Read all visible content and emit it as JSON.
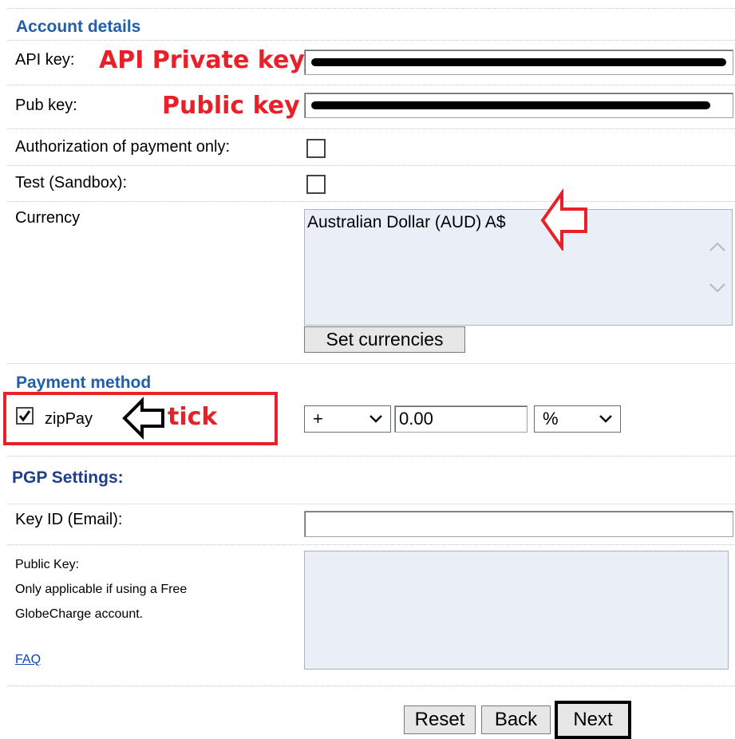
{
  "account": {
    "title": "Account details",
    "api_key_label": "API key:",
    "api_key_annotation": "API Private key",
    "pub_key_label": "Pub key:",
    "pub_key_annotation": "Public key",
    "auth_only_label": "Authorization of payment only:",
    "test_label": "Test (Sandbox):",
    "currency_label": "Currency",
    "currency_option": "Australian Dollar (AUD) A$",
    "set_currencies_label": "Set currencies"
  },
  "payment": {
    "title": "Payment method",
    "method_label": "zipPay",
    "tick_annotation": "tick",
    "sign_value": "+",
    "amount_value": "0.00",
    "unit_value": "%"
  },
  "pgp": {
    "title": "PGP Settings:",
    "key_id_label": "Key ID (Email):",
    "public_key_label": "Public Key:",
    "note_line1": "Only applicable if using a Free",
    "note_line2": "GlobeCharge account.",
    "faq_label": "FAQ"
  },
  "footer": {
    "reset_label": "Reset",
    "back_label": "Back",
    "next_label": "Next"
  },
  "colors": {
    "section_title": "#245ea8",
    "annotation_red": "#e8202a",
    "input_bg": "#e9eef7"
  },
  "icons": {
    "up": "chevron-up-icon",
    "down": "chevron-down-icon",
    "arrow_left": "arrow-left-outline-icon",
    "check": "checkmark-icon"
  }
}
